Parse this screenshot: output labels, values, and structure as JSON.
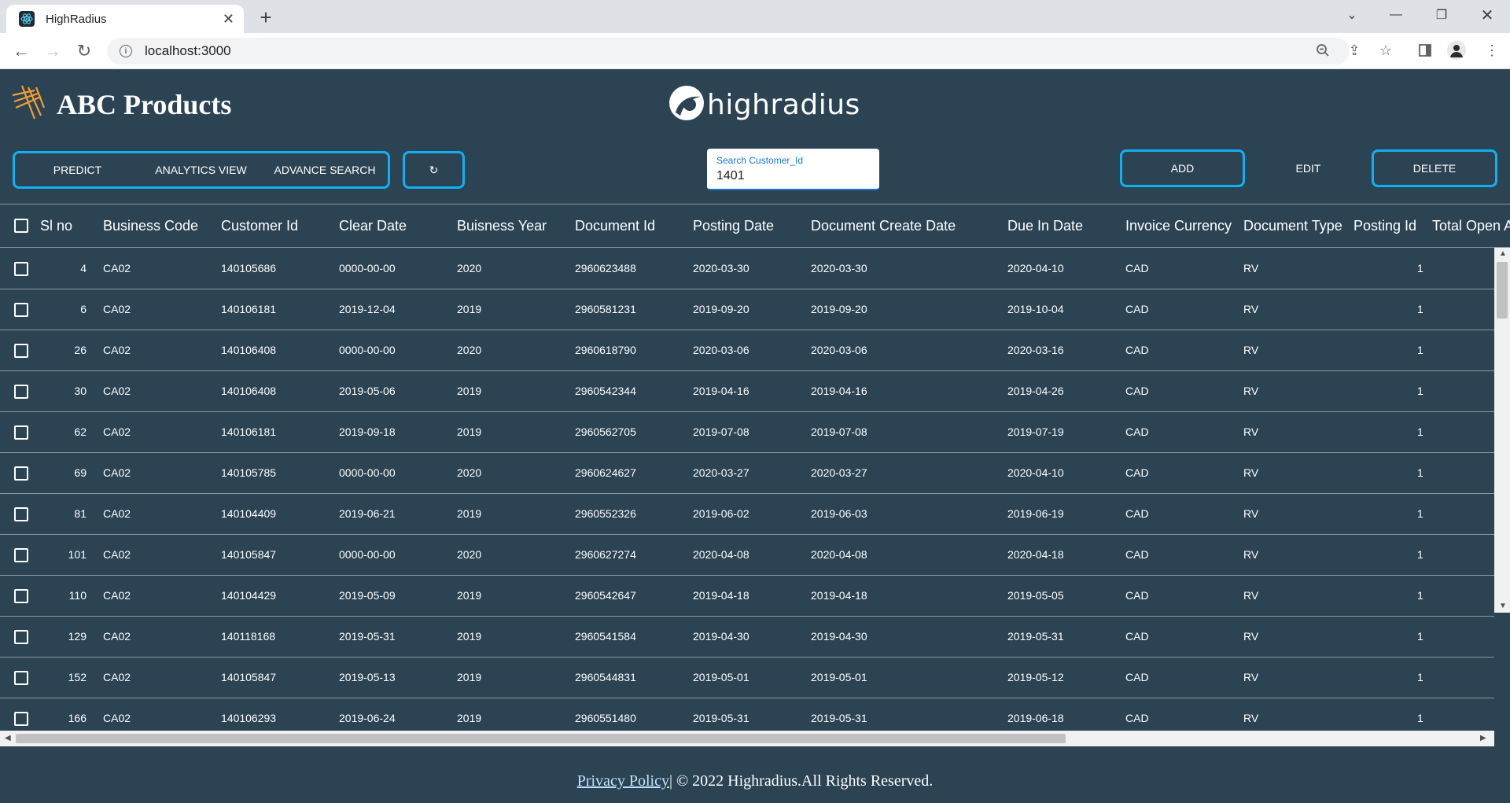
{
  "browser": {
    "tab_title": "HighRadius",
    "url": "localhost:3000"
  },
  "header": {
    "company_name": "ABC Products",
    "logo_text": "highradius"
  },
  "toolbar": {
    "predict_label": "PREDICT",
    "analytics_label": "ANALYTICS VIEW",
    "advance_search_label": "ADVANCE SEARCH",
    "refresh_symbol": "↻",
    "search_label": "Search Customer_Id",
    "search_value": "1401",
    "add_label": "ADD",
    "edit_label": "EDIT",
    "delete_label": "DELETE"
  },
  "table": {
    "columns": [
      "Sl no",
      "Business Code",
      "Customer Id",
      "Clear Date",
      "Buisness Year",
      "Document Id",
      "Posting Date",
      "Document Create Date",
      "Due In Date",
      "Invoice Currency",
      "Document Type",
      "Posting Id",
      "Total Open A"
    ],
    "rows": [
      [
        "4",
        "CA02",
        "140105686",
        "0000-00-00",
        "2020",
        "2960623488",
        "2020-03-30",
        "2020-03-30",
        "2020-04-10",
        "CAD",
        "RV",
        "1"
      ],
      [
        "6",
        "CA02",
        "140106181",
        "2019-12-04",
        "2019",
        "2960581231",
        "2019-09-20",
        "2019-09-20",
        "2019-10-04",
        "CAD",
        "RV",
        "1"
      ],
      [
        "26",
        "CA02",
        "140106408",
        "0000-00-00",
        "2020",
        "2960618790",
        "2020-03-06",
        "2020-03-06",
        "2020-03-16",
        "CAD",
        "RV",
        "1"
      ],
      [
        "30",
        "CA02",
        "140106408",
        "2019-05-06",
        "2019",
        "2960542344",
        "2019-04-16",
        "2019-04-16",
        "2019-04-26",
        "CAD",
        "RV",
        "1"
      ],
      [
        "62",
        "CA02",
        "140106181",
        "2019-09-18",
        "2019",
        "2960562705",
        "2019-07-08",
        "2019-07-08",
        "2019-07-19",
        "CAD",
        "RV",
        "1"
      ],
      [
        "69",
        "CA02",
        "140105785",
        "0000-00-00",
        "2020",
        "2960624627",
        "2020-03-27",
        "2020-03-27",
        "2020-04-10",
        "CAD",
        "RV",
        "1"
      ],
      [
        "81",
        "CA02",
        "140104409",
        "2019-06-21",
        "2019",
        "2960552326",
        "2019-06-02",
        "2019-06-03",
        "2019-06-19",
        "CAD",
        "RV",
        "1"
      ],
      [
        "101",
        "CA02",
        "140105847",
        "0000-00-00",
        "2020",
        "2960627274",
        "2020-04-08",
        "2020-04-08",
        "2020-04-18",
        "CAD",
        "RV",
        "1"
      ],
      [
        "110",
        "CA02",
        "140104429",
        "2019-05-09",
        "2019",
        "2960542647",
        "2019-04-18",
        "2019-04-18",
        "2019-05-05",
        "CAD",
        "RV",
        "1"
      ],
      [
        "129",
        "CA02",
        "140118168",
        "2019-05-31",
        "2019",
        "2960541584",
        "2019-04-30",
        "2019-04-30",
        "2019-05-31",
        "CAD",
        "RV",
        "1"
      ],
      [
        "152",
        "CA02",
        "140105847",
        "2019-05-13",
        "2019",
        "2960544831",
        "2019-05-01",
        "2019-05-01",
        "2019-05-12",
        "CAD",
        "RV",
        "1"
      ],
      [
        "166",
        "CA02",
        "140106293",
        "2019-06-24",
        "2019",
        "2960551480",
        "2019-05-31",
        "2019-05-31",
        "2019-06-18",
        "CAD",
        "RV",
        "1"
      ]
    ]
  },
  "footer": {
    "privacy_link": "Privacy Policy",
    "copyright": "| © 2022 Highradius.All Rights Reserved."
  }
}
